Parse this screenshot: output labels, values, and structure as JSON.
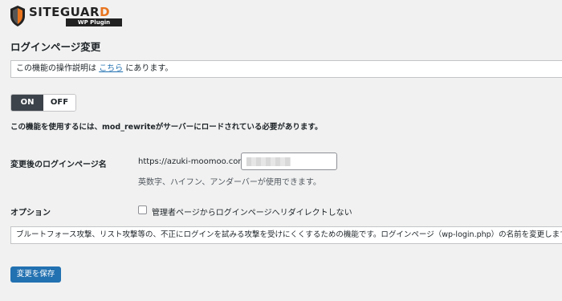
{
  "logo": {
    "brand_main": "SITEGUAR",
    "brand_last": "D",
    "sub": "WP Plugin",
    "colors": {
      "accent": "#e8741e",
      "dark": "#222222"
    }
  },
  "page_title": "ログインページ変更",
  "notice": {
    "prefix": "この機能の操作説明は",
    "link": "こちら",
    "suffix": "にあります。"
  },
  "toggle": {
    "on_label": "ON",
    "off_label": "OFF",
    "selected": "ON"
  },
  "rewrite_note": "この機能を使用するには、mod_rewriteがサーバーにロードされている必要があります。",
  "login_page": {
    "label": "変更後のログインページ名",
    "url_prefix": "https://azuki-moomoo.com/",
    "value": "",
    "hint": "英数字、ハイフン、アンダーバーが使用できます。"
  },
  "option": {
    "label": "オプション",
    "checkbox_label": "管理者ページからログインページへリダイレクトしない",
    "checked": false
  },
  "description": "ブルートフォース攻撃、リスト攻撃等の、不正にログインを試みる攻撃を受けにくくするための機能です。ログインページ（wp-login.php）の名前を変更します。",
  "save_button": "変更を保存",
  "colors": {
    "primary": "#2271b1",
    "toggle_on": "#3c434a",
    "background": "#f1f1f1"
  }
}
